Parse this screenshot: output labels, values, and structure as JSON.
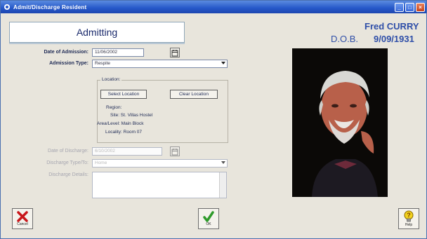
{
  "window": {
    "title": "Admit/Discharge Resident",
    "controls": {
      "minimize": "_",
      "maximize": "□",
      "close": "×"
    }
  },
  "header": {
    "tab_label": "Admitting"
  },
  "resident": {
    "name": "Fred CURRY",
    "dob_label": "D.O.B.",
    "dob": "9/09/1931"
  },
  "admission": {
    "date_label": "Date of Admission:",
    "date_value": "11/06/2002",
    "type_label": "Admission Type:",
    "type_value": "Respite"
  },
  "location": {
    "group_label": "Location:",
    "select_button": "Select Location",
    "clear_button": "Clear Location",
    "region_label": "Region:",
    "region_value": "Site: St. Villas Hostel",
    "area_text": "Area/Level: Main Block",
    "locality_text": "Locality: Room 07"
  },
  "discharge": {
    "date_label": "Date of Discharge:",
    "date_value": "6/10/2002",
    "type_label": "Discharge Type/To:",
    "type_value": "Home",
    "details_label": "Discharge Details:"
  },
  "buttons": {
    "cancel": "Cancel",
    "ok": "OK",
    "help": "Help"
  },
  "icons": {
    "app": "resident-app-icon",
    "calendar": "calendar-icon",
    "cancel": "red-x-icon",
    "ok": "green-checkmark-icon",
    "help": "lightbulb-question-icon"
  },
  "colors": {
    "title_bar": "#2557c8",
    "accent_text": "#2e4ea8",
    "panel": "#e8e5dc"
  }
}
